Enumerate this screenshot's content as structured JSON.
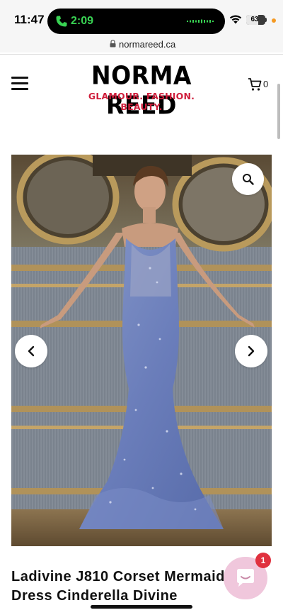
{
  "status_bar": {
    "time": "11:47",
    "call_timer": "2:09",
    "battery_level": "63",
    "battery_fraction": 0.63
  },
  "browser": {
    "url": "normareed.ca"
  },
  "header": {
    "logo_title": "NORMA REED",
    "logo_tagline": "GLAMOUR. FASHION. BEAUTY.",
    "cart_count": "0"
  },
  "product": {
    "title_line1": "Ladivine J810 Corset Mermaid",
    "title_line2": "Dress Cinderella Divine"
  },
  "chat": {
    "badge_count": "1"
  },
  "colors": {
    "tagline_red": "#cf1d3b",
    "call_green": "#39d353",
    "chat_pink": "#f0c7dc",
    "badge_red": "#e0313f",
    "dress_blue": "#6f83bd"
  },
  "icons": [
    "phone-icon",
    "wifi-icon",
    "lock-icon",
    "hamburger-menu-icon",
    "cart-icon",
    "search-icon",
    "chevron-left-icon",
    "chevron-right-icon",
    "chat-icon"
  ]
}
